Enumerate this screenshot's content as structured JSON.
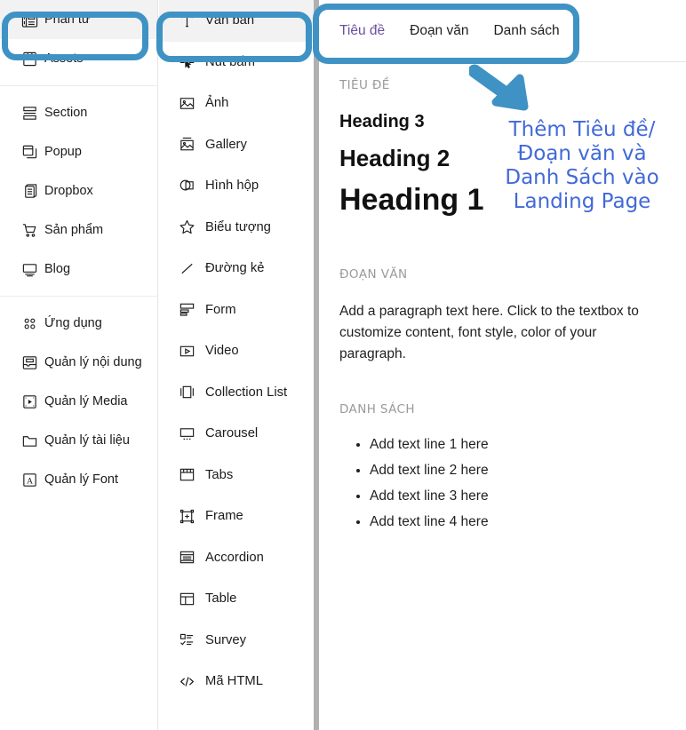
{
  "sidebar": {
    "groups": [
      {
        "items": [
          {
            "label": "Phần tử",
            "icon": "elements-icon",
            "active": true
          },
          {
            "label": "Assets",
            "icon": "bookmark-icon",
            "active": false
          }
        ]
      },
      {
        "items": [
          {
            "label": "Section",
            "icon": "section-icon",
            "active": false
          },
          {
            "label": "Popup",
            "icon": "popup-icon",
            "active": false
          },
          {
            "label": "Dropbox",
            "icon": "dropbox-icon",
            "active": false
          },
          {
            "label": "Sản phẩm",
            "icon": "cart-icon",
            "active": false
          },
          {
            "label": "Blog",
            "icon": "blog-icon",
            "active": false
          }
        ]
      },
      {
        "items": [
          {
            "label": "Ứng dụng",
            "icon": "apps-grid-icon",
            "active": false
          },
          {
            "label": "Quản lý nội dung",
            "icon": "content-manager-icon",
            "active": false
          },
          {
            "label": "Quản lý Media",
            "icon": "media-manager-icon",
            "active": false
          },
          {
            "label": "Quản lý tài liệu",
            "icon": "folder-icon",
            "active": false
          },
          {
            "label": "Quản lý Font",
            "icon": "font-icon",
            "active": false
          }
        ]
      }
    ]
  },
  "elements": {
    "items": [
      {
        "label": "Văn bản",
        "icon": "text-t-icon",
        "active": true
      },
      {
        "label": "Nút bấm",
        "icon": "button-cursor-icon",
        "active": false
      },
      {
        "label": "Ảnh",
        "icon": "image-icon",
        "active": false
      },
      {
        "label": "Gallery",
        "icon": "gallery-icon",
        "active": false
      },
      {
        "label": "Hình hộp",
        "icon": "shape-icon",
        "active": false
      },
      {
        "label": "Biểu tượng",
        "icon": "star-icon",
        "active": false
      },
      {
        "label": "Đường kẻ",
        "icon": "line-icon",
        "active": false
      },
      {
        "label": "Form",
        "icon": "form-icon",
        "active": false
      },
      {
        "label": "Video",
        "icon": "video-play-icon",
        "active": false
      },
      {
        "label": "Collection List",
        "icon": "collection-list-icon",
        "active": false
      },
      {
        "label": "Carousel",
        "icon": "carousel-icon",
        "active": false
      },
      {
        "label": "Tabs",
        "icon": "tabs-icon",
        "active": false
      },
      {
        "label": "Frame",
        "icon": "frame-icon",
        "active": false
      },
      {
        "label": "Accordion",
        "icon": "accordion-icon",
        "active": false
      },
      {
        "label": "Table",
        "icon": "table-icon",
        "active": false
      },
      {
        "label": "Survey",
        "icon": "survey-icon",
        "active": false
      },
      {
        "label": "Mã HTML",
        "icon": "code-icon",
        "active": false
      }
    ]
  },
  "preview": {
    "tabs": [
      {
        "label": "Tiêu đề",
        "selected": true
      },
      {
        "label": "Đoạn văn",
        "selected": false
      },
      {
        "label": "Danh sách",
        "selected": false
      }
    ],
    "heading_section": {
      "label": "TIÊU ĐỀ",
      "h3": "Heading 3",
      "h2": "Heading 2",
      "h1": "Heading 1"
    },
    "paragraph_section": {
      "label": "ĐOẠN VĂN",
      "text": "Add a paragraph text here. Click to the textbox to customize content, font style, color of your paragraph."
    },
    "list_section": {
      "label": "DANH SÁCH",
      "items": [
        "Add text line 1 here",
        "Add text line 2 here",
        "Add text line 3 here",
        "Add text line 4 here"
      ]
    }
  },
  "annotation": {
    "arrow": "down-right-arrow-icon",
    "lines": [
      "Thêm Tiêu đề/",
      "Đoạn văn và",
      "Danh Sách vào",
      "Landing Page"
    ],
    "text": "Thêm Tiêu đề/ Đoạn văn và Danh Sách vào Landing Page"
  },
  "colors": {
    "highlight": "#3f92c4",
    "annotation_text": "#4169d8",
    "selected_tab": "#6b4fa0",
    "panel_bg": "#ffffff",
    "active_item_bg": "#f2f2f2"
  }
}
